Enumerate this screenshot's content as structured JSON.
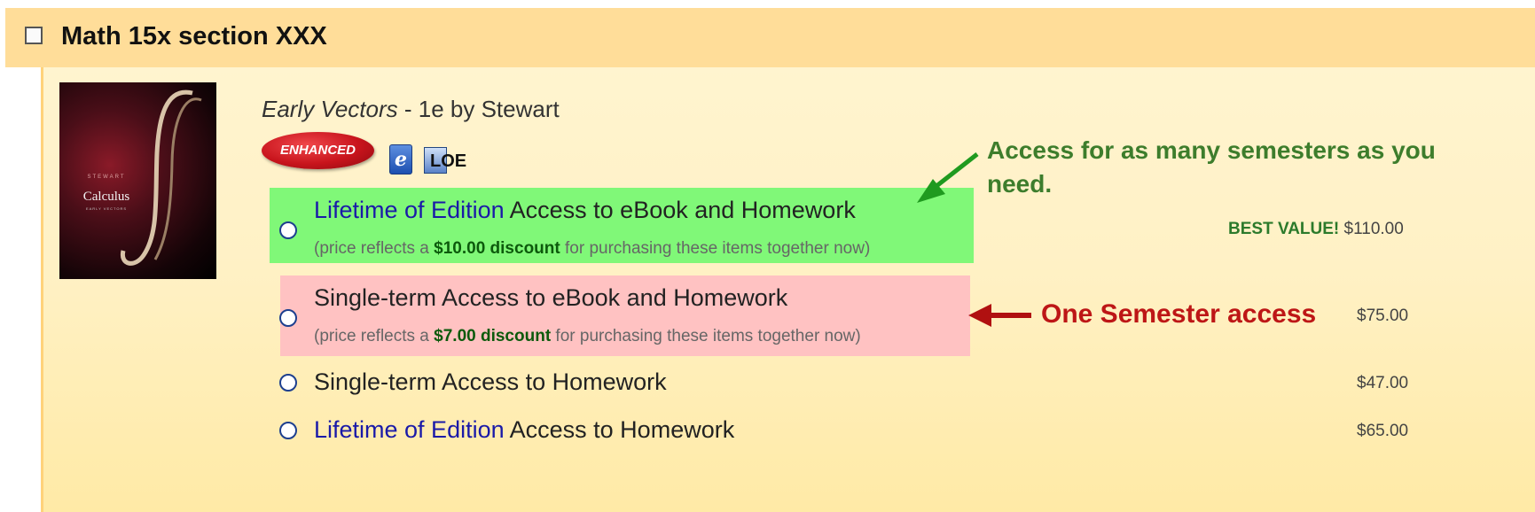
{
  "section": {
    "title": "Math 15x section XXX"
  },
  "book": {
    "title": "Early Vectors",
    "edition_author": " - 1e by Stewart",
    "cover": {
      "author": "STEWART",
      "title": "Calculus",
      "subtitle": "EARLY VECTORS"
    },
    "badges": {
      "enhanced": "ENHANCED",
      "ebook_icon": "e",
      "loe_icon": "LOE"
    }
  },
  "options": [
    {
      "lifetime": "Lifetime of Edition",
      "text": " Access to eBook and Homework",
      "discount_prefix": "(price reflects a ",
      "discount_amount": "$10.00 discount",
      "discount_suffix": " for purchasing these items together now)",
      "best_value": "BEST VALUE!",
      "price": "$110.00",
      "selected": false
    },
    {
      "text": "Single-term Access to eBook and Homework",
      "discount_prefix": "(price reflects a ",
      "discount_amount": "$7.00 discount",
      "discount_suffix": " for purchasing these items together now)",
      "price": "$75.00",
      "selected": false
    },
    {
      "text": "Single-term Access to Homework",
      "price": "$47.00",
      "selected": false
    },
    {
      "lifetime": "Lifetime of Edition",
      "text": " Access to Homework",
      "price": "$65.00",
      "selected": false
    }
  ],
  "annotations": {
    "green_callout": "Access for as many semesters as you need.",
    "red_callout": "One Semester access"
  },
  "colors": {
    "header_bg": "#ffdd99",
    "green_highlight": "#80f878",
    "pink_highlight": "#ffc2c2",
    "green_arrow": "#1f9a1f",
    "red_arrow": "#b01010"
  }
}
